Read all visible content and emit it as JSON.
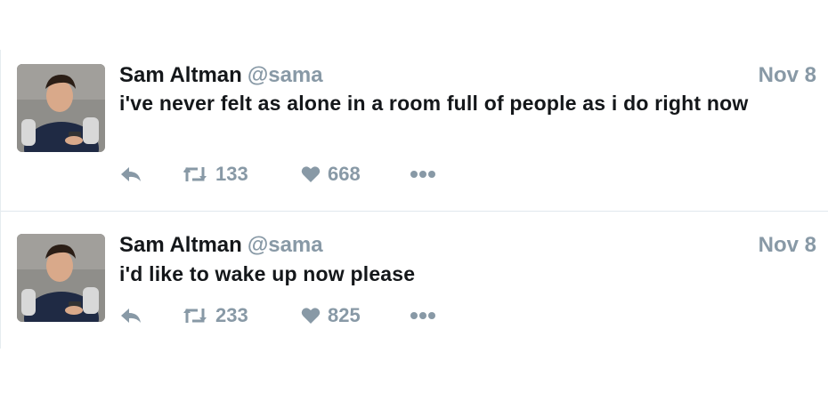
{
  "tweets": [
    {
      "author_name": "Sam Altman",
      "handle": "@sama",
      "date": "Nov 8",
      "text": "i've never felt as alone in a room full of people as i do right now",
      "retweets": "133",
      "likes": "668"
    },
    {
      "author_name": "Sam Altman",
      "handle": "@sama",
      "date": "Nov 8",
      "text": "i'd like to wake up now please",
      "retweets": "233",
      "likes": "825"
    }
  ],
  "colors": {
    "text": "#14171a",
    "muted": "#8899a6",
    "divider": "#e1e8ed"
  },
  "icons": {
    "reply": "reply-icon",
    "retweet": "retweet-icon",
    "like": "heart-icon",
    "more": "more-dots-icon"
  }
}
